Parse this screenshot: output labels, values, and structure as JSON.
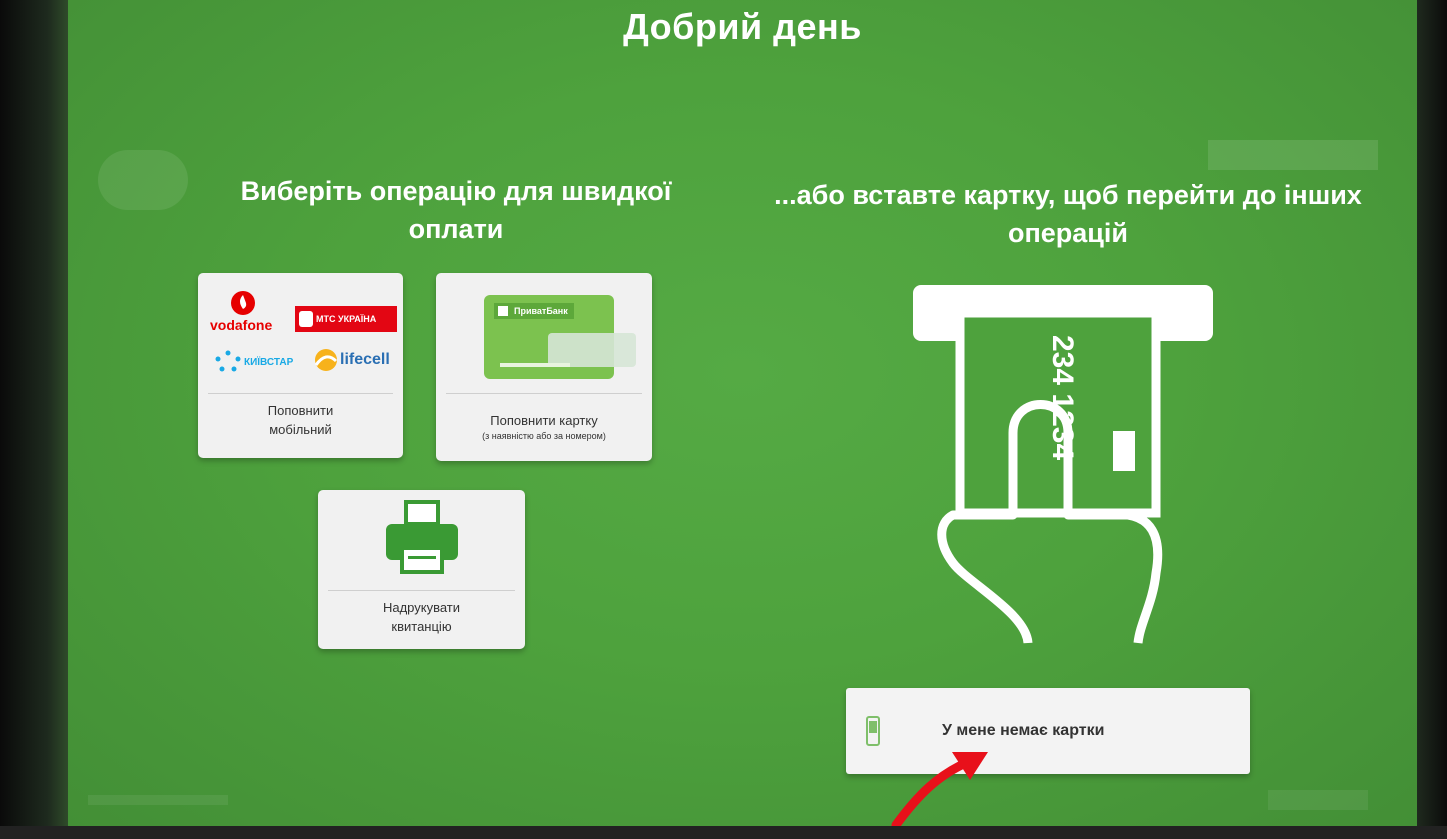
{
  "screen": {
    "title": "Добрий день",
    "left_heading": "Виберіть операцію для швидкої оплати",
    "right_heading": "...або вставте картку, щоб перейти до інших операцій"
  },
  "tiles": {
    "mobile": {
      "label_line1": "Поповнити",
      "label_line2": "мобільний",
      "logos": {
        "vodafone": "vodafone",
        "mts": "МТС УКРАЇНА",
        "kyivstar": "КИЇВСТАР",
        "lifecell": "lifecell"
      }
    },
    "card": {
      "label": "Поповнити картку",
      "sublabel": "(з наявністю або за номером)",
      "card_brand": "ПриватБанк"
    },
    "print": {
      "label_line1": "Надрукувати",
      "label_line2": "квитанцію"
    }
  },
  "card_illustration": {
    "number": "234 1234"
  },
  "no_card_button": {
    "label": "У мене немає картки",
    "icon": "mobile-phone-icon"
  },
  "colors": {
    "background": "#4ea23d",
    "tile": "#f1f1f1",
    "arrow": "#e8101a"
  }
}
